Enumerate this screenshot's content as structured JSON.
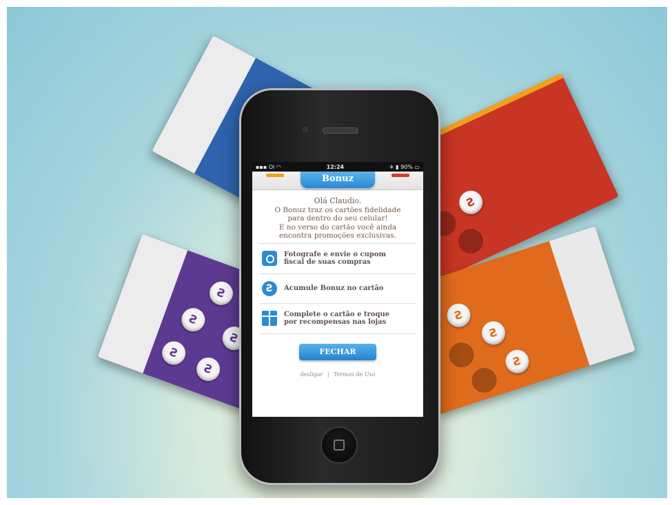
{
  "status_bar": {
    "carrier": "Oi",
    "time": "12:24",
    "battery": "90%"
  },
  "app": {
    "title": "Bonuz"
  },
  "intro": {
    "greeting": "Olá Claudio.",
    "line1": "O Bonuz traz os cartões fidelidade",
    "line2": "para dentro do seu celular!",
    "line3": "E no verso do cartão você ainda",
    "line4": "encontra promoções exclusivas."
  },
  "features": [
    {
      "icon": "camera-icon",
      "line1": "Fotografe e envie o cupom",
      "line2": "fiscal de suas compras"
    },
    {
      "icon": "bonuz-coin-icon",
      "line1": "Acumule Bonuz no cartão",
      "line2": ""
    },
    {
      "icon": "gift-icon",
      "line1": "Complete o cartão e troque",
      "line2": "por recompensas nas lojas"
    }
  ],
  "button": {
    "label": "FECHAR"
  },
  "links": {
    "logout": "desligar",
    "separator": "|",
    "terms": "Termos de Uso"
  },
  "colors": {
    "accent": "#2c8ad4",
    "card_blue": "#2f63ad",
    "card_purple": "#5d3a92",
    "card_red": "#c93524",
    "card_orange": "#e06b1c"
  }
}
